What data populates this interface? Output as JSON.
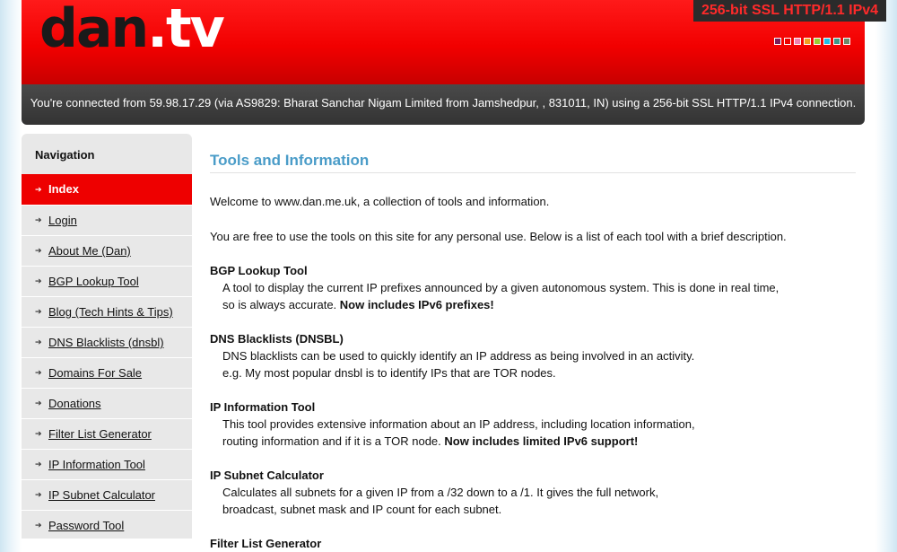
{
  "header": {
    "logo": {
      "main": "dan",
      "dot": ".",
      "suffix": "tv"
    },
    "ssl_badge": "256-bit SSL HTTP/1.1 IPv4",
    "swatches": [
      "#7a1f5c",
      "#ee0000",
      "#f080b0",
      "#f0a020",
      "#9acd32",
      "#1ec0e8",
      "#3a9a8a",
      "#6a8a6a"
    ]
  },
  "connection": {
    "message": "You're connected from 59.98.17.29 (via AS9829: Bharat Sanchar Nigam Limited from Jamshedpur, , 831011, IN) using a 256-bit SSL HTTP/1.1 IPv4 connection."
  },
  "sidebar": {
    "title": "Navigation",
    "items": [
      {
        "label": "Index"
      },
      {
        "label": "Login"
      },
      {
        "label": "About Me (Dan)"
      },
      {
        "label": "BGP Lookup Tool"
      },
      {
        "label": "Blog (Tech Hints & Tips)"
      },
      {
        "label": "DNS Blacklists (dnsbl)"
      },
      {
        "label": "Domains For Sale"
      },
      {
        "label": "Donations"
      },
      {
        "label": "Filter List Generator"
      },
      {
        "label": "IP Information Tool"
      },
      {
        "label": "IP Subnet Calculator"
      },
      {
        "label": "Password Tool"
      }
    ]
  },
  "main": {
    "title": "Tools and Information",
    "intro1": "Welcome to www.dan.me.uk, a collection of tools and information.",
    "intro2": "You are free to use the tools on this site for any personal use. Below is a list of each tool with a brief description.",
    "tools": [
      {
        "name": "BGP Lookup Tool",
        "line1": "A tool to display the current IP prefixes announced by a given autonomous system. This is done in real time,",
        "line2": "so is always accurate. ",
        "highlight": "Now includes IPv6 prefixes!"
      },
      {
        "name": "DNS Blacklists (DNSBL)",
        "line1": "DNS blacklists can be used to quickly identify an IP address as being involved in an activity.",
        "line2": "e.g. My most popular dnsbl is to identify IPs that are TOR nodes.",
        "highlight": ""
      },
      {
        "name": "IP Information Tool",
        "line1": "This tool provides extensive information about an IP address, including location information,",
        "line2": "routing information and if it is a TOR node. ",
        "highlight": "Now includes limited IPv6 support!"
      },
      {
        "name": "IP Subnet Calculator",
        "line1": "Calculates all subnets for a given IP from a /32 down to a /1. It gives the full network,",
        "line2": "broadcast, subnet mask and IP count for each subnet.",
        "highlight": ""
      },
      {
        "name": "Filter List Generator",
        "line1": "",
        "line2": "",
        "highlight": ""
      }
    ]
  }
}
